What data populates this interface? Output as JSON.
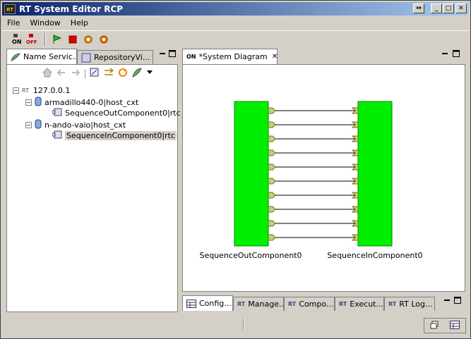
{
  "app": {
    "title": "RT System Editor RCP",
    "icon_text": "RT"
  },
  "window_controls": {
    "restore": "↔",
    "minimize": "_",
    "maximize": "□",
    "close": "✕"
  },
  "menu": {
    "items": [
      "File",
      "Window",
      "Help"
    ]
  },
  "toolbar": {
    "on_label": "ON",
    "off_label": "OFF",
    "icons": [
      "all-on-icon",
      "all-off-icon",
      "activate-icon",
      "deactivate-icon",
      "gear-icon",
      "gear-orange-icon"
    ]
  },
  "left_panel": {
    "tabs": [
      {
        "label": "Name Servic...",
        "icon": "name-service-icon"
      },
      {
        "label": "RepositoryVi...",
        "icon": "repository-icon"
      }
    ],
    "tree": {
      "root": "127.0.0.1",
      "root_prefix": "RT",
      "nodes": [
        {
          "label": "armadillo440-0|host_cxt",
          "child": "SequenceOutComponent0|rtc"
        },
        {
          "label": "n-ando-vaio|host_cxt",
          "child": "SequenceInComponent0|rtc"
        }
      ]
    }
  },
  "editor": {
    "tab_label": "*System Diagram",
    "tab_icon": "ON",
    "components": [
      {
        "name": "SequenceOutComponent0",
        "color": "#00ee00"
      },
      {
        "name": "SequenceInComponent0",
        "color": "#00ee00"
      }
    ],
    "port_count": 10
  },
  "bottom_tabs": [
    {
      "label": "Config...",
      "icon": "table-icon"
    },
    {
      "label": "Manage...",
      "icon": "rt-icon"
    },
    {
      "label": "Compo...",
      "icon": "rt-icon"
    },
    {
      "label": "Execut...",
      "icon": "rt-icon"
    },
    {
      "label": "RT Log...",
      "icon": "rt-icon"
    }
  ],
  "colors": {
    "titlebar_start": "#0a246a",
    "titlebar_end": "#a6caf0",
    "component_fill": "#00ee00",
    "port_fill": "#a0e080"
  }
}
